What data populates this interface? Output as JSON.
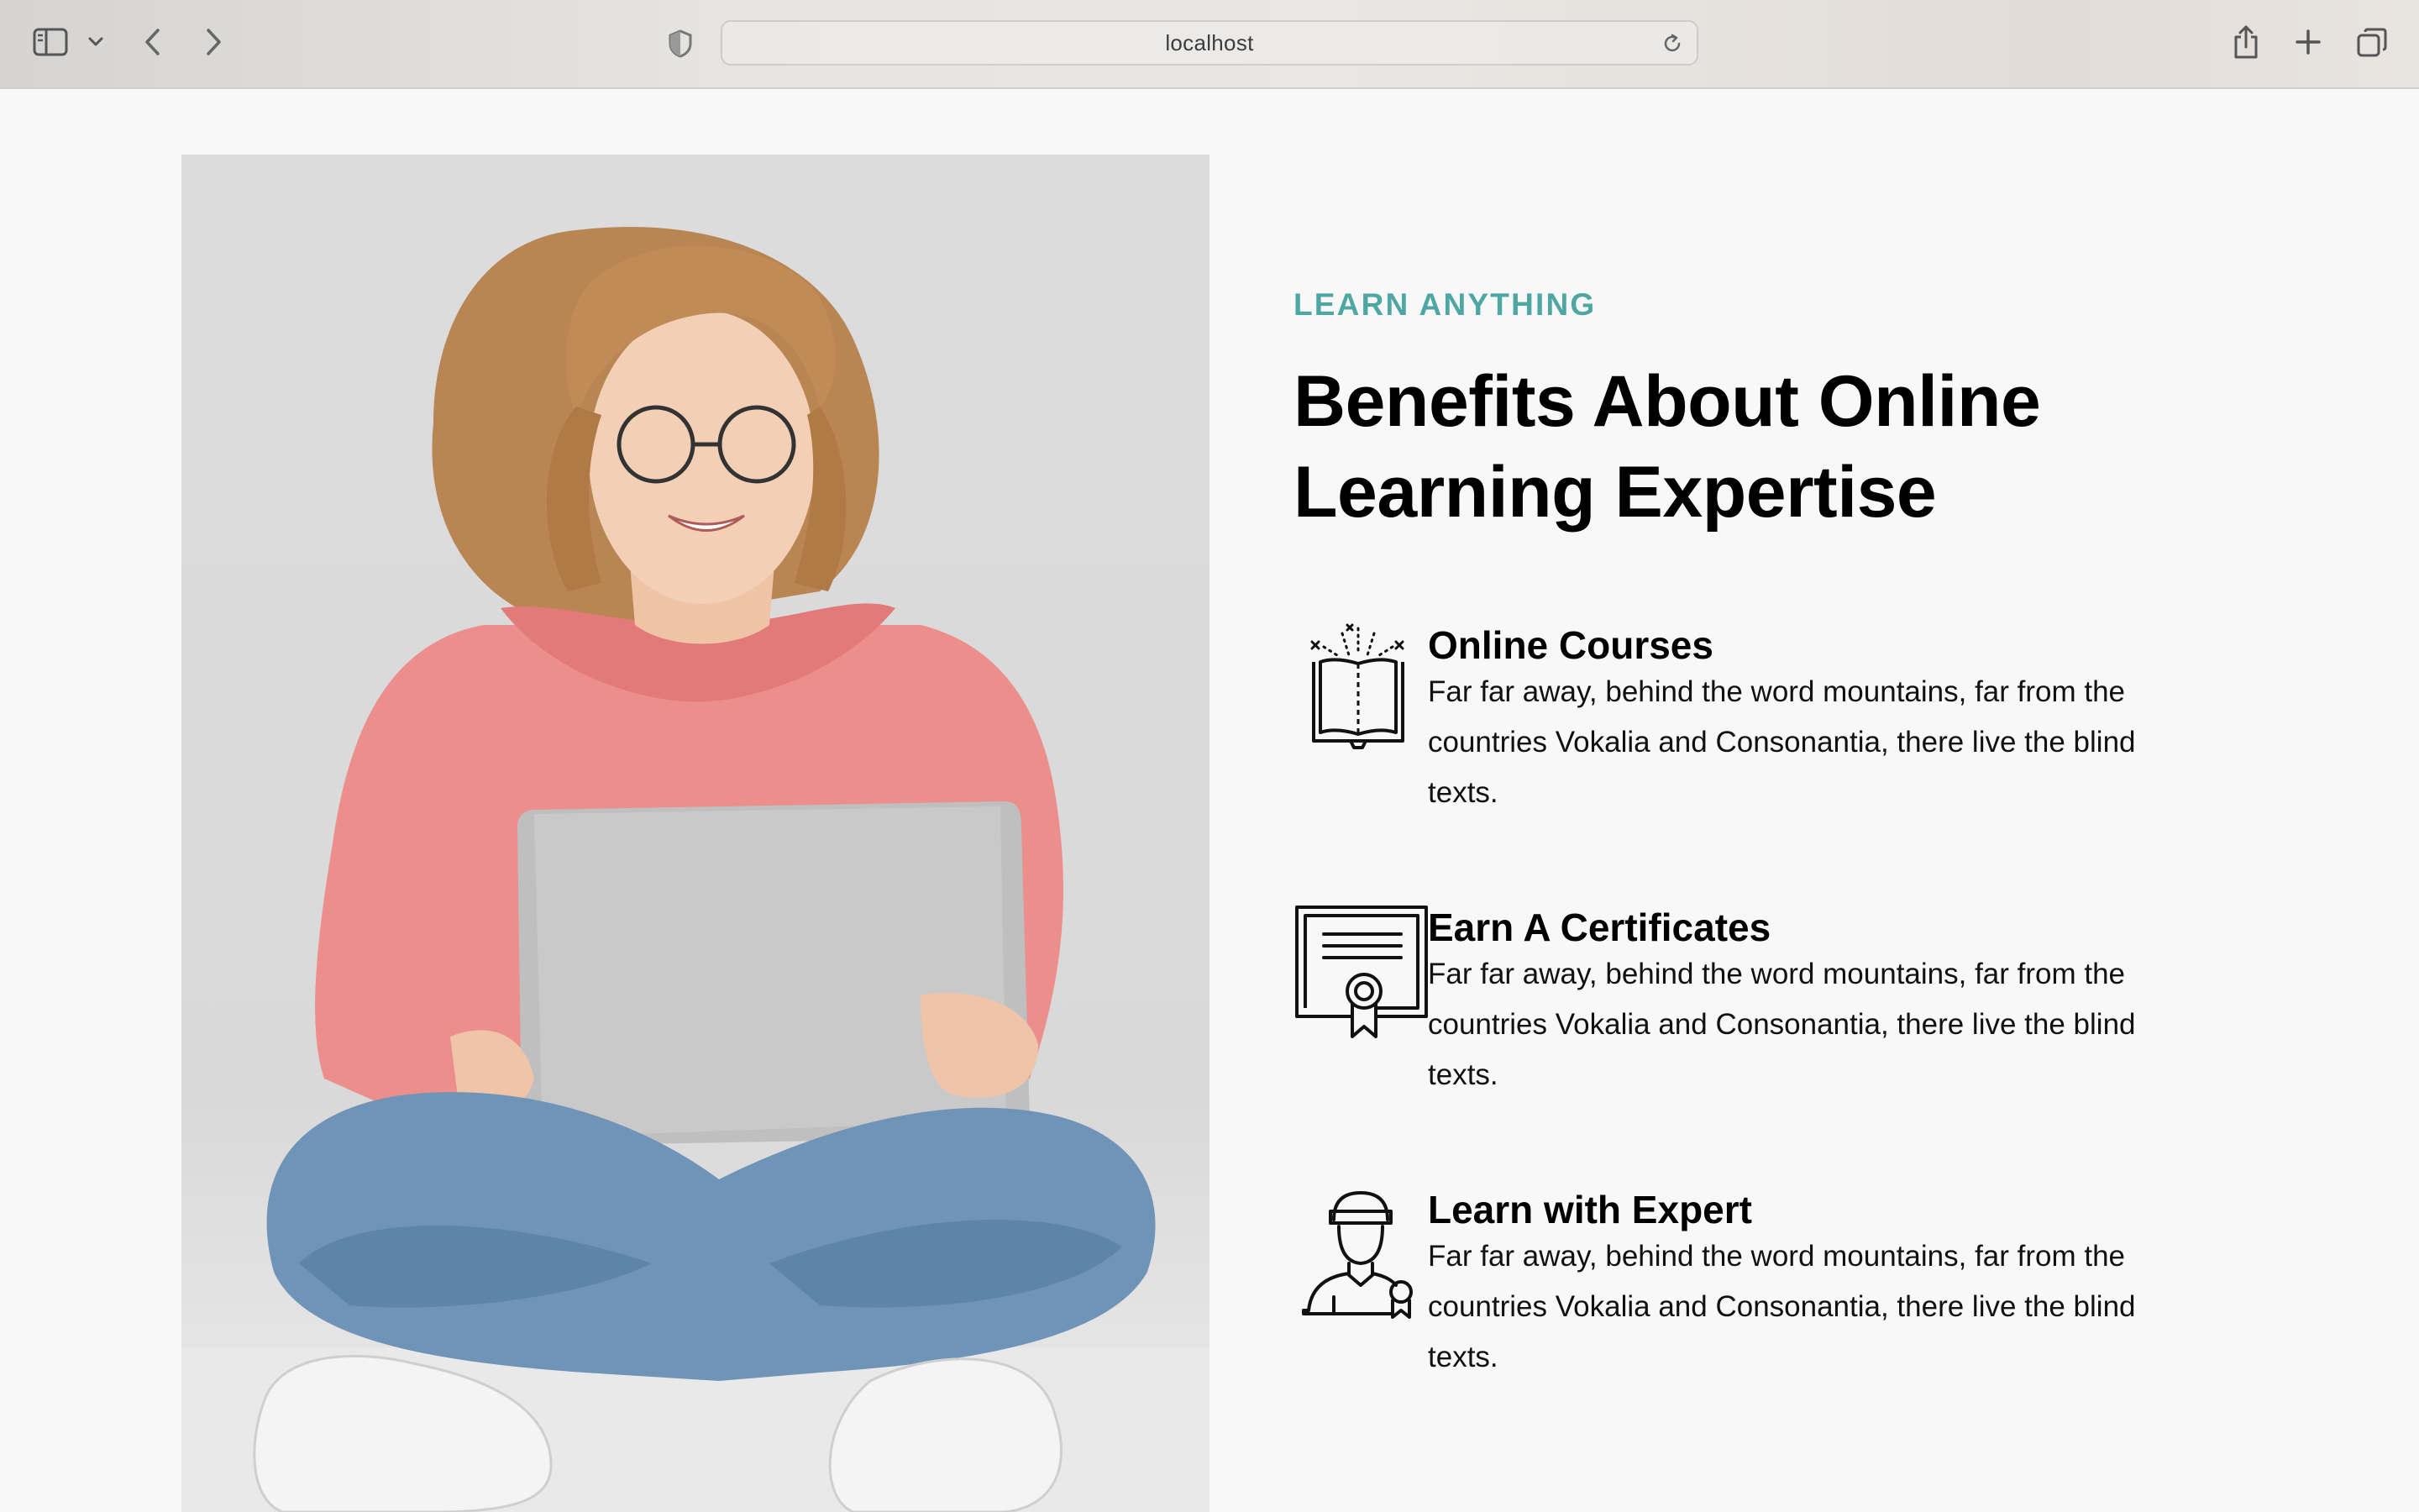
{
  "browser": {
    "address": "localhost",
    "icons": [
      "sidebar-icon",
      "chevron-down-icon",
      "back-arrow-icon",
      "forward-arrow-icon",
      "privacy-shield-icon",
      "reload-icon",
      "share-icon",
      "new-tab-icon",
      "tab-overview-icon"
    ]
  },
  "section": {
    "subheading": "LEARN ANYTHING",
    "title": "Benefits About Online Learning Expertise",
    "accent_color": "#4ea7a2",
    "features": [
      {
        "icon": "open-book-icon",
        "title": "Online Courses",
        "text": "Far far away, behind the word mountains, far from the countries Vokalia and Consonantia, there live the blind texts."
      },
      {
        "icon": "certificate-icon",
        "title": "Earn A Certificates",
        "text": "Far far away, behind the word mountains, far from the countries Vokalia and Consonantia, there live the blind texts."
      },
      {
        "icon": "expert-person-icon",
        "title": "Learn with Expert",
        "text": "Far far away, behind the word mountains, far from the countries Vokalia and Consonantia, there live the blind texts."
      }
    ]
  }
}
